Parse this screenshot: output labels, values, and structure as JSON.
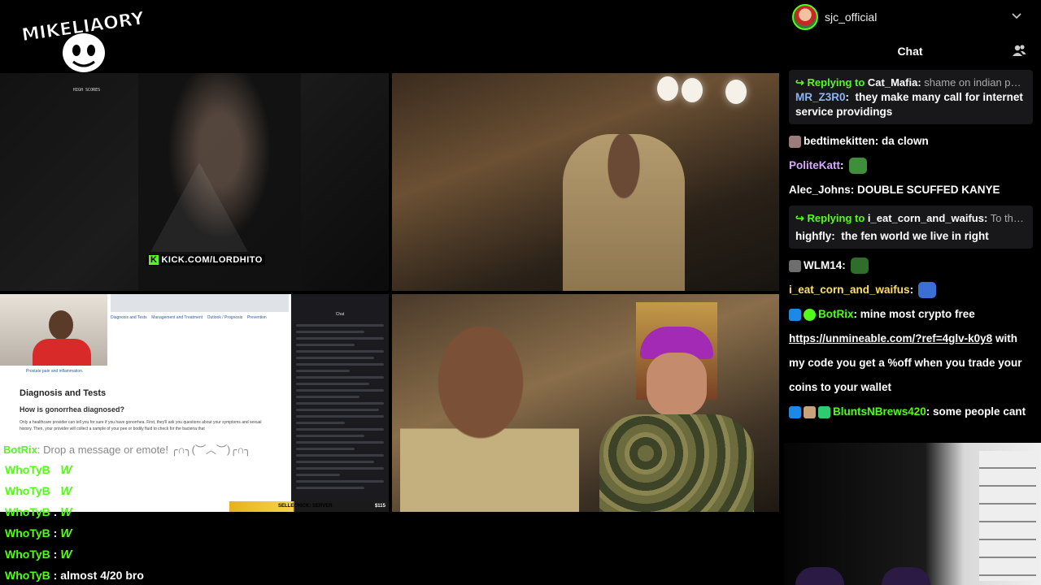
{
  "logo": {
    "text": "MIKELIAORY"
  },
  "tiles": {
    "t1": {
      "kick_label": "KICK.COM/LORDHITO",
      "scores_title": "HIGH SCORES"
    },
    "t3": {
      "article_nav": [
        "Diagnosis and Tests",
        "Management and Treatment",
        "Outlook / Prognosis",
        "Prevention"
      ],
      "bullet": "Prostate pain and inflammation.",
      "heading": "Diagnosis and Tests",
      "subheading": "How is gonorrhea diagnosed?",
      "paragraph": "Only a healthcare provider can tell you for sure if you have gonorrhea. First, they'll ask you questions about your symptoms and sexual history. Then, your provider will collect a sample of your pee or bodily fluid to check for the bacteria that",
      "mini_chat_title": "Chat",
      "overlay_message": {
        "name": "BotRix",
        "text": ": Drop a message or emote! ╭∩╮(︶︿︶)╭∩╮"
      },
      "donation": {
        "text": "SELLECHICK: SERVER",
        "amount": "$115"
      }
    }
  },
  "overlay_chat": [
    {
      "name": "WhoTyB",
      "msg": "W"
    },
    {
      "name": "WhoTyB",
      "msg": "W"
    },
    {
      "name": "WhoTyB",
      "msg": "W"
    },
    {
      "name": "WhoTyB",
      "msg": "W"
    },
    {
      "name": "WhoTyB",
      "msg": "W"
    },
    {
      "name": "WhoTyB",
      "msg": "almost 4/20 bro"
    }
  ],
  "panel": {
    "channel_name": "sjc_official",
    "chat_title": "Chat",
    "messages": {
      "reply1": {
        "label": "Replying to",
        "target": "Cat_Mafia:",
        "quote": "shame on indian peo..."
      },
      "msg1": {
        "user": "MR_Z3R0",
        "user_color": "#8ab4f8",
        "text": "they make many call for internet service providings"
      },
      "msg2": {
        "user": "bedtimekitten",
        "user_color": "#ffffff",
        "text": "da clown"
      },
      "msg3": {
        "user": "PoliteKatt",
        "user_color": "#d8a8ff",
        "text": ""
      },
      "msg4": {
        "user": "Alec_Johns",
        "user_color": "#ffffff",
        "text": "DOUBLE SCUFFED KANYE"
      },
      "reply2": {
        "label": "Replying to",
        "target": "i_eat_corn_and_waifus:",
        "quote": "To them ..."
      },
      "msg5": {
        "user": "highfly",
        "user_color": "#ffffff",
        "text": "the fen world we live in right"
      },
      "msg6": {
        "user": "WLM14",
        "user_color": "#ffffff",
        "text": ""
      },
      "msg7": {
        "user": "i_eat_corn_and_waifus",
        "user_color": "#ffe066",
        "text": ""
      },
      "msg8": {
        "user": "BotRix",
        "user_color": "#53fc18",
        "text": "mine most crypto free"
      },
      "msg8b": {
        "link": "https://unmineable.com/?ref=4glv-k0y8",
        "text1": " with",
        "text2": "my code you get a %off when you trade your",
        "text3": "coins to your wallet"
      },
      "msg9": {
        "user": "BluntsNBrews420",
        "user_color": "#53fc18",
        "text": "some people cant"
      }
    }
  },
  "colors": {
    "kick_green": "#53fc18",
    "panel_bg": "#000000",
    "reply_bg": "#18181b"
  },
  "icons": [
    "chevron-down-icon",
    "users-icon",
    "sword-badge-icon",
    "verified-badge-icon",
    "gift-badge-icon"
  ]
}
